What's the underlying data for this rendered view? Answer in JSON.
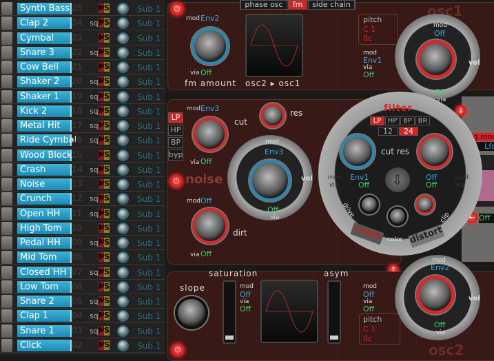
{
  "sounds": [
    {
      "name": "Synth Bass",
      "num": "25",
      "sq": false
    },
    {
      "name": "Clap 2",
      "num": "24",
      "sq": true
    },
    {
      "name": "Cymbal",
      "num": "23",
      "sq": false
    },
    {
      "name": "Snare 3",
      "num": "22",
      "sq": true
    },
    {
      "name": "Cow Bell",
      "num": "21",
      "sq": false
    },
    {
      "name": "Shaker 2",
      "num": "20",
      "sq": true
    },
    {
      "name": "Shaker 1",
      "num": "19",
      "sq": true
    },
    {
      "name": "Kick 2",
      "num": "18",
      "sq": true
    },
    {
      "name": "Metal Hit",
      "num": "17",
      "sq": true
    },
    {
      "name": "Ride Cymbal",
      "num": "16",
      "sq": true
    },
    {
      "name": "Wood Block",
      "num": "15",
      "sq": false
    },
    {
      "name": "Crash",
      "num": "14",
      "sq": true
    },
    {
      "name": "Noise",
      "num": "13",
      "sq": false
    },
    {
      "name": "Crunch",
      "num": "12",
      "sq": true
    },
    {
      "name": "Open HH",
      "num": "11",
      "sq": true
    },
    {
      "name": "High Tom",
      "num": "10",
      "sq": false
    },
    {
      "name": "Pedal HH",
      "num": "09",
      "sq": true
    },
    {
      "name": "Mid Tom",
      "num": "08",
      "sq": false
    },
    {
      "name": "Closed HH",
      "num": "07",
      "sq": true
    },
    {
      "name": "Low Tom",
      "num": "06",
      "sq": false
    },
    {
      "name": "Snare 2",
      "num": "05",
      "sq": true
    },
    {
      "name": "Clap 1",
      "num": "04",
      "sq": true
    },
    {
      "name": "Snare 1",
      "num": "03",
      "sq": true
    },
    {
      "name": "Click",
      "num": "02",
      "sq": false
    }
  ],
  "row_labels": {
    "sq": "sq",
    "mute": "M",
    "solo": "S",
    "output": "Sub 1"
  },
  "osc1": {
    "title": "osc1",
    "modes": [
      "phase osc",
      "fm",
      "side chain"
    ],
    "active_mode": "fm",
    "fm_mod": "mod",
    "fm_mod_value": "Env2",
    "fm_via": "via",
    "fm_via_value": "Off",
    "fm_label": "fm amount",
    "wave_label": "osc2 ▸ osc1",
    "pitch_label": "pitch",
    "pitch_note": "C 1",
    "pitch_cents": "0c",
    "pitch_mod": "mod",
    "pitch_mod_value": "Env1",
    "pitch_via": "via",
    "pitch_via_value": "Off",
    "vol_mod": "mod",
    "vol_mod_value": "Off",
    "vol_label": "vol",
    "vol_via_value": "Off",
    "vol_via": "via"
  },
  "noise": {
    "title": "noise",
    "filter_types": [
      "LP",
      "HP",
      "BP",
      "byp"
    ],
    "active_type": "LP",
    "cut_mod": "mod",
    "cut_mod_value": "Env3",
    "cut_label": "cut",
    "cut_via": "via",
    "cut_via_value": "Off",
    "res_label": "res",
    "vol_mod": "mod",
    "vol_mod_value": "Env3",
    "vol_label": "vol",
    "vol_via_value": "Off",
    "vol_via": "via",
    "dirt_mod": "mod",
    "dirt_mod_value": "Off",
    "dirt_label": "dirt",
    "dirt_via": "via",
    "dirt_via_value": "Off"
  },
  "filter": {
    "title": "filter",
    "types": [
      "LP",
      "HP",
      "BP",
      "BR"
    ],
    "active_type": "LP",
    "slopes": [
      "12",
      "24"
    ],
    "active_slope": "24",
    "cut_res_label": "cut res",
    "mod_left": "mod",
    "via_left": "via",
    "mod_right": "mod",
    "via_right": "via",
    "cut_mod_value": "Env1",
    "cut_via_value": "Off",
    "res_mod_value": "Off",
    "res_via_value": "Off",
    "drive": "drive",
    "color": "color",
    "clip": "clip",
    "crush": "crush",
    "distort": "distort"
  },
  "ring": {
    "label": "ring mod",
    "lfo": "Lfo",
    "off": "Off"
  },
  "osc2": {
    "title": "osc2",
    "slope_label": "slope",
    "saturation_label": "saturation",
    "asym_label": "asym",
    "sat_mod": "mod",
    "sat_mod_value": "Off",
    "sat_via": "via",
    "sat_via_value": "Off",
    "asym_mod": "mod",
    "asym_mod_value": "Off",
    "asym_via": "via",
    "asym_via_value": "Off",
    "pitch_label": "pitch",
    "pitch_note": "C 1",
    "pitch_cents": "0c",
    "vol_mod": "mod",
    "vol_mod_value": "Env2",
    "vol_label": "vol",
    "vol_via_value": "Off",
    "vol_via": "via"
  }
}
